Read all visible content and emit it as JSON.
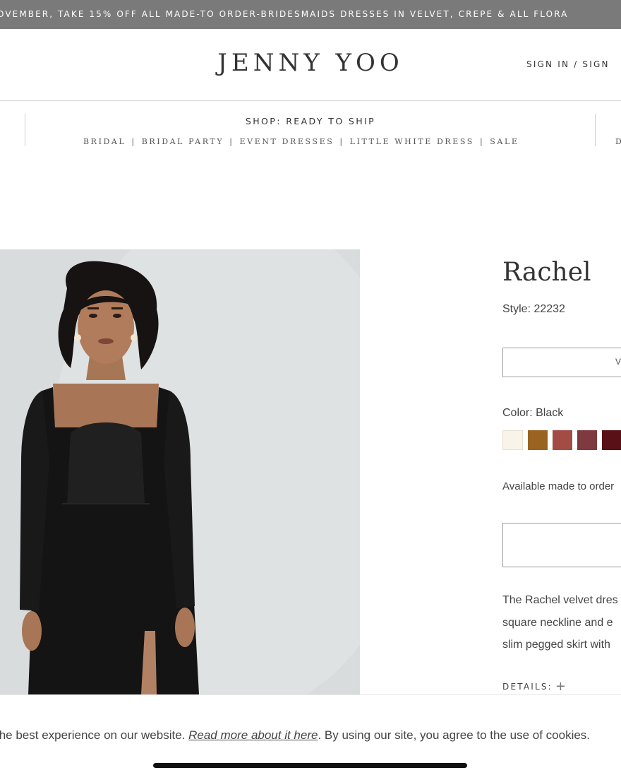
{
  "promo": {
    "text": "OVEMBER, TAKE 15% OFF ALL MADE-TO ORDER-BRIDESMAIDS DRESSES IN VELVET, CREPE & ALL FLORA"
  },
  "header": {
    "logo": "JENNY YOO",
    "signin": "SIGN IN / SIGN"
  },
  "nav": {
    "title": "SHOP: READY TO SHIP",
    "links": [
      "BRIDAL",
      "BRIDAL PARTY",
      "EVENT DRESSES",
      "LITTLE WHITE DRESS",
      "SALE"
    ],
    "separator": "|",
    "overflow_letter": "D"
  },
  "product": {
    "name": "Rachel",
    "style": "Style: 22232",
    "select_value_fragment": "V",
    "color_label": "Color: Black",
    "swatches": [
      {
        "name": "cream",
        "color": "#f8f4ea"
      },
      {
        "name": "bronze",
        "color": "#9a6420"
      },
      {
        "name": "terracotta",
        "color": "#a24c45"
      },
      {
        "name": "mauve",
        "color": "#7e3a3f"
      },
      {
        "name": "burgundy",
        "color": "#5a1017"
      }
    ],
    "availability": "Available made to order",
    "description_lines": [
      "The Rachel velvet dres",
      "square neckline and e",
      "slim pegged skirt with"
    ],
    "details_label": "DETAILS:",
    "details_icon": "+"
  },
  "cookie": {
    "text_before": "the best experience on our website. ",
    "link": "Read more about it here",
    "text_after": ". By using our site, you agree to the use of cookies."
  }
}
